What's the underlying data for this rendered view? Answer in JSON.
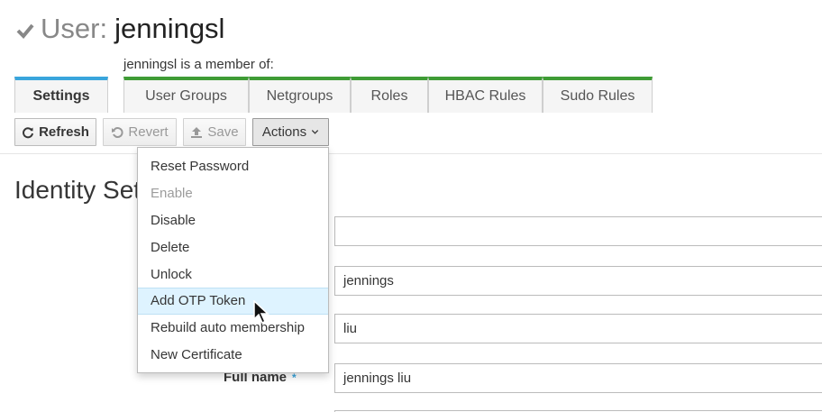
{
  "header": {
    "title_prefix": "User:",
    "username": "jenningsl",
    "check_icon": "check-icon"
  },
  "member_of_label": "jenningsl is a member of:",
  "tabs": [
    {
      "label": "Settings",
      "active": true
    },
    {
      "label": "User Groups"
    },
    {
      "label": "Netgroups"
    },
    {
      "label": "Roles"
    },
    {
      "label": "HBAC Rules"
    },
    {
      "label": "Sudo Rules"
    }
  ],
  "toolbar": {
    "refresh_label": "Refresh",
    "revert_label": "Revert",
    "save_label": "Save",
    "actions_label": "Actions"
  },
  "section": {
    "title": "Identity Set"
  },
  "actions_menu": [
    {
      "label": "Reset Password"
    },
    {
      "label": "Enable",
      "disabled": true
    },
    {
      "label": "Disable"
    },
    {
      "label": "Delete"
    },
    {
      "label": "Unlock"
    },
    {
      "label": "Add OTP Token",
      "hovered": true
    },
    {
      "label": "Rebuild auto membership"
    },
    {
      "label": "New Certificate"
    }
  ],
  "fields": {
    "field1_value": "",
    "first_name_value": "jennings",
    "last_name_value": "liu",
    "full_name_label": "Full name",
    "full_name_required": "*",
    "full_name_value": "jennings liu"
  },
  "colors": {
    "active_tab": "#39a5dc",
    "member_tab": "#3f9c35",
    "hover_bg": "#def3ff",
    "required": "#39a5dc"
  }
}
